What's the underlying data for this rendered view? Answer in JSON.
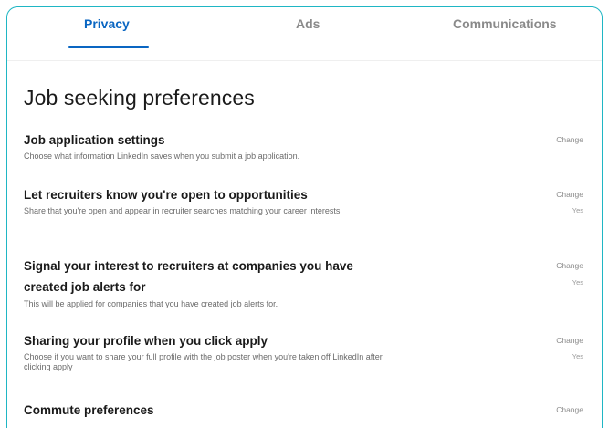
{
  "tabs": {
    "privacy": "Privacy",
    "ads": "Ads",
    "communications": "Communications"
  },
  "page_title": "Job seeking preferences",
  "settings": [
    {
      "title": "Job application settings",
      "description": "Choose what information LinkedIn saves when you submit a job application.",
      "action": "Change",
      "value": ""
    },
    {
      "title": "Let recruiters know you're open to opportunities",
      "description": "Share that you're open and appear in recruiter searches matching your career interests",
      "action": "Change",
      "value": "Yes"
    },
    {
      "title": "Signal your interest to recruiters at companies you have created job alerts for",
      "description": "This will be applied for companies that you have created job alerts for.",
      "action": "Change",
      "value": "Yes"
    },
    {
      "title": "Sharing your profile when you click apply",
      "description": "Choose if you want to share your full profile with the job poster when you're taken off LinkedIn after clicking apply",
      "action": "Change",
      "value": "Yes"
    },
    {
      "title": "Commute preferences",
      "description": "",
      "action": "Change",
      "value": ""
    }
  ],
  "colors": {
    "accent": "#0a66c2",
    "frame_border": "#1fb6c4"
  }
}
